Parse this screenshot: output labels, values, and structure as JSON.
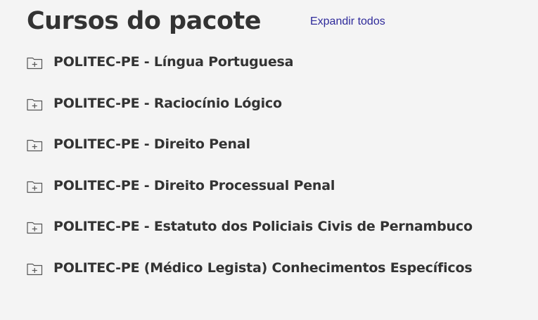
{
  "header": {
    "title": "Cursos do pacote",
    "expand_all_label": "Expandir todos"
  },
  "courses": [
    {
      "label": "POLITEC-PE - Língua Portuguesa",
      "icon": "folder-plus-icon"
    },
    {
      "label": "POLITEC-PE - Raciocínio Lógico",
      "icon": "folder-plus-icon"
    },
    {
      "label": "POLITEC-PE - Direito Penal",
      "icon": "folder-plus-icon"
    },
    {
      "label": "POLITEC-PE - Direito Processual Penal",
      "icon": "folder-plus-icon"
    },
    {
      "label": "POLITEC-PE - Estatuto dos Policiais Civis de Pernambuco",
      "icon": "folder-plus-icon"
    },
    {
      "label": "POLITEC-PE (Médico Legista) Conhecimentos Específicos",
      "icon": "folder-plus-icon"
    }
  ],
  "colors": {
    "background": "#f4f4f4",
    "text": "#333333",
    "link": "#2e2a9a"
  }
}
